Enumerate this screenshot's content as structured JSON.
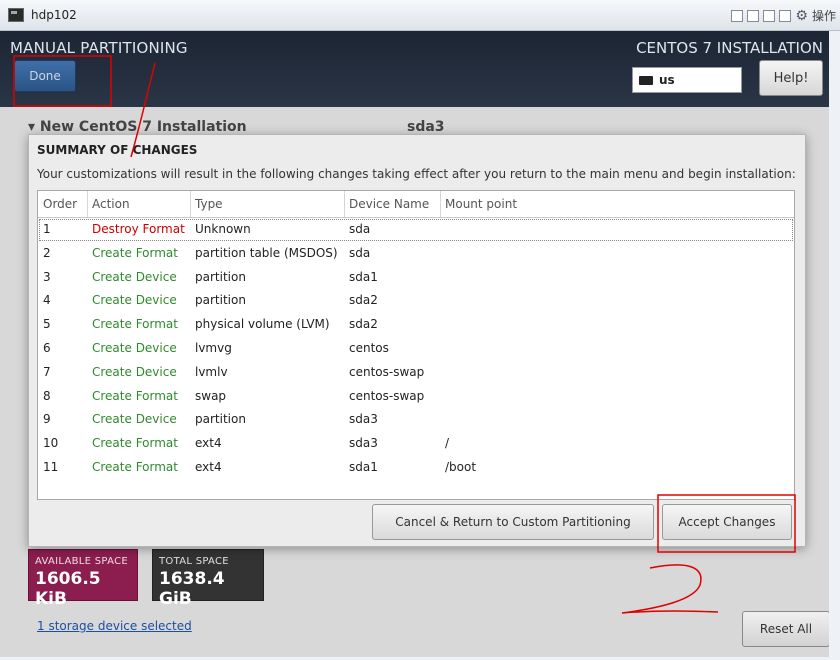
{
  "window": {
    "title": "hdp102",
    "menu_label": "操作"
  },
  "header": {
    "spoke_title": "MANUAL PARTITIONING",
    "done_label": "Done",
    "product_title": "CENTOS 7 INSTALLATION",
    "keyboard_layout": "us",
    "help_label": "Help!"
  },
  "background": {
    "installation_header": "New CentOS 7 Installation",
    "selected_device": "sda3",
    "available_space_label": "AVAILABLE SPACE",
    "available_space_value": "1606.5 KiB",
    "total_space_label": "TOTAL SPACE",
    "total_space_value": "1638.4 GiB",
    "storage_link": "1 storage device selected",
    "reset_label": "Reset All"
  },
  "dialog": {
    "title": "SUMMARY OF CHANGES",
    "description": "Your customizations will result in the following changes taking effect after you return to the main menu and begin installation:",
    "columns": [
      "Order",
      "Action",
      "Type",
      "Device Name",
      "Mount point"
    ],
    "rows": [
      {
        "order": "1",
        "action": "Destroy Format",
        "type": "Unknown",
        "device": "sda",
        "mount": ""
      },
      {
        "order": "2",
        "action": "Create Format",
        "type": "partition table (MSDOS)",
        "device": "sda",
        "mount": ""
      },
      {
        "order": "3",
        "action": "Create Device",
        "type": "partition",
        "device": "sda1",
        "mount": ""
      },
      {
        "order": "4",
        "action": "Create Device",
        "type": "partition",
        "device": "sda2",
        "mount": ""
      },
      {
        "order": "5",
        "action": "Create Format",
        "type": "physical volume (LVM)",
        "device": "sda2",
        "mount": ""
      },
      {
        "order": "6",
        "action": "Create Device",
        "type": "lvmvg",
        "device": "centos",
        "mount": ""
      },
      {
        "order": "7",
        "action": "Create Device",
        "type": "lvmlv",
        "device": "centos-swap",
        "mount": ""
      },
      {
        "order": "8",
        "action": "Create Format",
        "type": "swap",
        "device": "centos-swap",
        "mount": ""
      },
      {
        "order": "9",
        "action": "Create Device",
        "type": "partition",
        "device": "sda3",
        "mount": ""
      },
      {
        "order": "10",
        "action": "Create Format",
        "type": "ext4",
        "device": "sda3",
        "mount": "/"
      },
      {
        "order": "11",
        "action": "Create Format",
        "type": "ext4",
        "device": "sda1",
        "mount": "/boot"
      }
    ],
    "cancel_label": "Cancel & Return to Custom Partitioning",
    "accept_label": "Accept Changes"
  },
  "colors": {
    "destroy_action": "#cc0000",
    "create_action": "#2e8b2e",
    "annotation": "#e00000"
  },
  "annotations": {
    "handwritten_number": "2"
  }
}
